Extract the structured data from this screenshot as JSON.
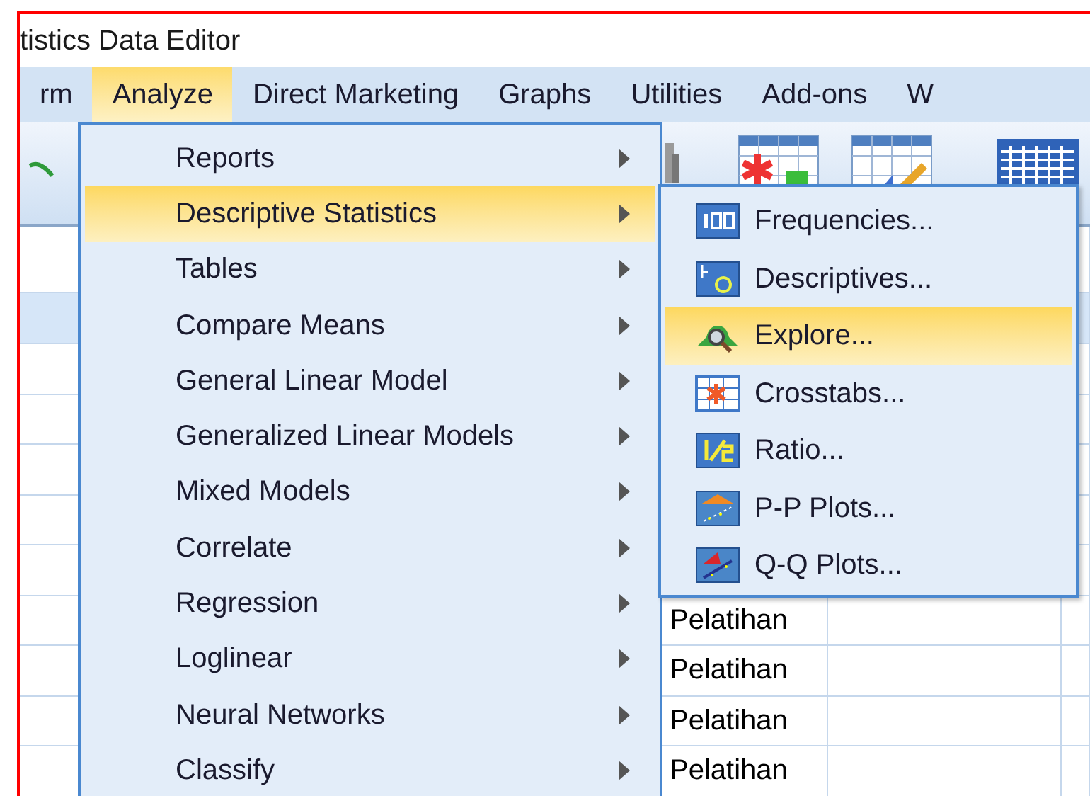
{
  "window": {
    "title": "tistics Data Editor"
  },
  "menu_bar": [
    {
      "label": "rm",
      "selected": false
    },
    {
      "label": "Analyze",
      "selected": true
    },
    {
      "label": "Direct Marketing",
      "selected": false
    },
    {
      "label": "Graphs",
      "selected": false
    },
    {
      "label": "Utilities",
      "selected": false
    },
    {
      "label": "Add-ons",
      "selected": false
    },
    {
      "label": "W",
      "selected": false
    }
  ],
  "analyze_menu": [
    {
      "label": "Reports",
      "selected": false,
      "submenu": true
    },
    {
      "label": "Descriptive Statistics",
      "selected": true,
      "submenu": true
    },
    {
      "label": "Tables",
      "selected": false,
      "submenu": true
    },
    {
      "label": "Compare Means",
      "selected": false,
      "submenu": true
    },
    {
      "label": "General Linear Model",
      "selected": false,
      "submenu": true
    },
    {
      "label": "Generalized Linear Models",
      "selected": false,
      "submenu": true
    },
    {
      "label": "Mixed Models",
      "selected": false,
      "submenu": true
    },
    {
      "label": "Correlate",
      "selected": false,
      "submenu": true
    },
    {
      "label": "Regression",
      "selected": false,
      "submenu": true
    },
    {
      "label": "Loglinear",
      "selected": false,
      "submenu": true
    },
    {
      "label": "Neural Networks",
      "selected": false,
      "submenu": true
    },
    {
      "label": "Classify",
      "selected": false,
      "submenu": true
    }
  ],
  "descriptive_statistics_menu": [
    {
      "label": "Frequencies...",
      "selected": false,
      "kind": "frequencies"
    },
    {
      "label": "Descriptives...",
      "selected": false,
      "kind": "descriptives"
    },
    {
      "label": "Explore...",
      "selected": true,
      "kind": "explore"
    },
    {
      "label": "Crosstabs...",
      "selected": false,
      "kind": "crosstabs"
    },
    {
      "label": "Ratio...",
      "selected": false,
      "kind": "ratio"
    },
    {
      "label": "P-P Plots...",
      "selected": false,
      "kind": "pp"
    },
    {
      "label": "Q-Q Plots...",
      "selected": false,
      "kind": "qq"
    }
  ],
  "data_grid": {
    "column_2_cells": [
      "Pelatihan",
      "Pelatihan",
      "Pelatihan",
      "Pelatihan"
    ]
  }
}
